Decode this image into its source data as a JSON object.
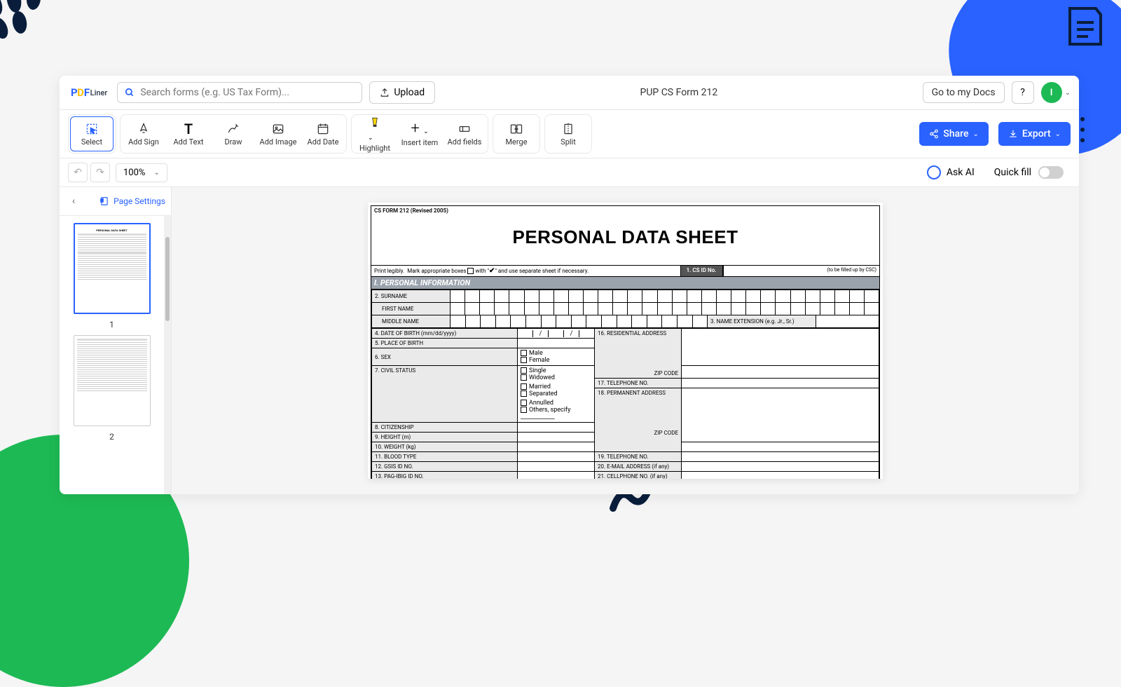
{
  "header": {
    "search_placeholder": "Search forms (e.g. US Tax Form)...",
    "upload_label": "Upload",
    "doc_title": "PUP CS Form 212",
    "goto_docs": "Go to my Docs",
    "help": "?",
    "avatar": "I"
  },
  "toolbar": {
    "select": "Select",
    "add_sign": "Add Sign",
    "add_text": "Add Text",
    "draw": "Draw",
    "add_image": "Add Image",
    "add_date": "Add Date",
    "highlight": "Highlight",
    "insert_item": "Insert item",
    "add_fields": "Add fields",
    "merge": "Merge",
    "split": "Split",
    "share": "Share",
    "export": "Export"
  },
  "secondary": {
    "zoom": "100%",
    "ask_ai": "Ask AI",
    "quick_fill": "Quick fill"
  },
  "sidebar": {
    "page_settings": "Page Settings",
    "thumbs": [
      "1",
      "2"
    ]
  },
  "form": {
    "revision": "CS FORM 212 (Revised 2005)",
    "title": "PERSONAL DATA SHEET",
    "instruction": "Print legibly.  Mark appropriate boxes ☐ with \" ✔ \" and use separate sheet if necessary.",
    "csid_label": "1.  CS ID No.",
    "csid_note": "(to be filled up by CSC)",
    "section1": "I. PERSONAL INFORMATION",
    "rows": {
      "surname": "2.  SURNAME",
      "firstname": "FIRST NAME",
      "middlename": "MIDDLE NAME",
      "name_ext": "3. NAME EXTENSION (e.g. Jr., Sr.)",
      "dob": "4.  DATE OF BIRTH (mm/dd/yyyy)",
      "pob": "5.  PLACE OF BIRTH",
      "sex": "6.  SEX",
      "sex_male": "Male",
      "sex_female": "Female",
      "civil": "7.  CIVIL STATUS",
      "cs_single": "Single",
      "cs_widowed": "Widowed",
      "cs_married": "Married",
      "cs_separated": "Separated",
      "cs_annulled": "Annulled",
      "cs_others": "Others, specify ____________",
      "citizenship": "8.  CITIZENSHIP",
      "height": "9.  HEIGHT (m)",
      "weight": "10. WEIGHT (kg)",
      "blood": "11. BLOOD TYPE",
      "gsis": "12. GSIS ID NO.",
      "pagibig": "13. PAG-IBIG ID NO.",
      "res_addr": "16. RESIDENTIAL ADDRESS",
      "zip": "ZIP CODE",
      "tel": "17. TELEPHONE NO.",
      "perm_addr": "18. PERMANENT ADDRESS",
      "tel2": "19. TELEPHONE NO.",
      "email": "20. E-MAIL ADDRESS (if any)",
      "cell": "21. CELLPHONE NO. (if any)"
    }
  }
}
